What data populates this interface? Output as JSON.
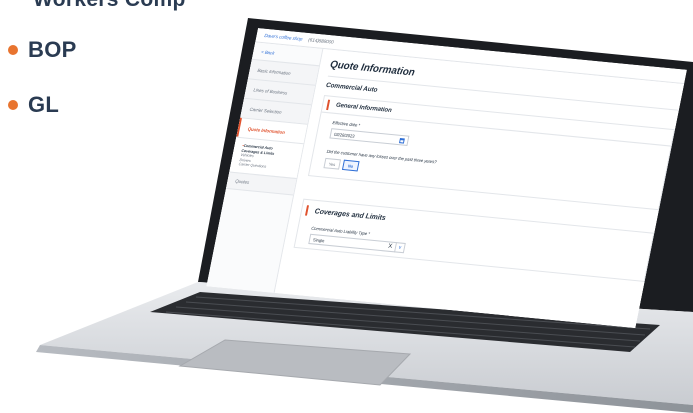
{
  "slide": {
    "bullets": [
      "Workers Comp",
      "BOP",
      "GL"
    ],
    "bullet_color": "#e8742f",
    "text_color": "#2a3b52"
  },
  "app": {
    "topbar": {
      "shop_name": "Dave's coffee shop",
      "phone": "(614)888000"
    },
    "sidebar": {
      "back_label": "< Back",
      "items": [
        {
          "label": "Basic Information"
        },
        {
          "label": "Lines of Business"
        },
        {
          "label": "Carrier Selection"
        },
        {
          "label": "Quote Information"
        }
      ],
      "sub_items": [
        "Commercial Auto",
        "Coverages & Limits",
        "Vehicles",
        "Drivers",
        "Carrier Questions"
      ],
      "quotes_label": "Quotes"
    },
    "main": {
      "title": "Quote Information",
      "subtitle": "Commercial Auto",
      "general": {
        "heading": "General Information",
        "effective_label": "Effective date *",
        "effective_value": "02/28/2023",
        "losses_question": "Did the customer have any losses over the past three years?",
        "yes_label": "Yes",
        "no_label": "No",
        "selected": "No"
      },
      "coverages": {
        "heading": "Coverages and Limits",
        "liability_label": "Commercial Auto Liability Type *",
        "liability_value": "Single",
        "clear_symbol": "X",
        "dropdown_symbol": "v"
      }
    },
    "accent_color": "#e0522e",
    "link_color": "#2f6fd6"
  }
}
